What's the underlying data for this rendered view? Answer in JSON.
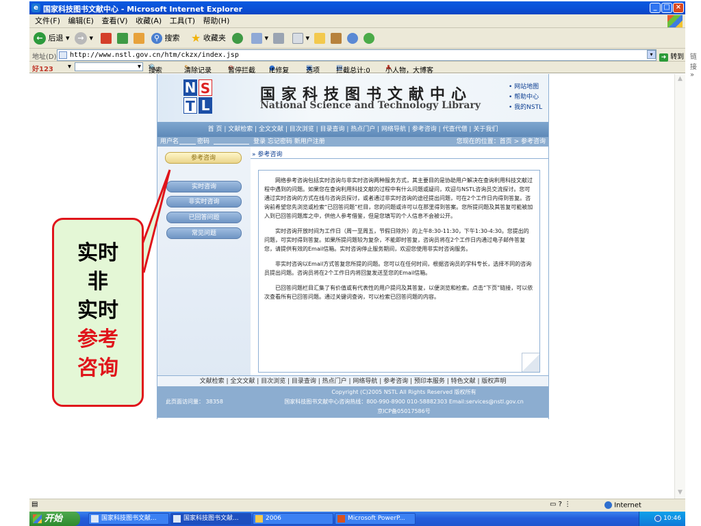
{
  "window": {
    "title": "国家科技图书文献中心 - Microsoft Internet Explorer"
  },
  "menu": [
    "文件(F)",
    "编辑(E)",
    "查看(V)",
    "收藏(A)",
    "工具(T)",
    "帮助(H)"
  ],
  "toolbar": {
    "back": "后退",
    "search": "搜索",
    "favorites": "收藏夹"
  },
  "address": {
    "label": "地址(D)",
    "url": "http://www.nstl.gov.cn/htm/ckzx/index.jsp",
    "go": "转到",
    "links": "链接"
  },
  "linksbar": {
    "brand": "好123",
    "search": "搜索",
    "clear": "清除记录",
    "block": "暂停拦截",
    "iefix": "IE修复",
    "options": "选项",
    "blocked": "拦截总计:0",
    "people": "小人物，大博客"
  },
  "site": {
    "logo_letters": [
      "N",
      "S",
      "T",
      "L"
    ],
    "title_cn": "国家科技图书文献中心",
    "title_en": "National Science and Technology Library",
    "toplinks": [
      "网站地图",
      "帮助中心",
      "我的NSTL"
    ],
    "nav": "首 页 | 文献检索 | 全文文献 | 目次浏览 | 目录查询 | 热点门户 | 网络导航 | 参考咨询 | 代查代借 | 关于我们",
    "login": {
      "user": "用户名",
      "password": "密码",
      "links": "登录 忘记密码 新用户注册",
      "location": "您现在的位置：首页 > 参考咨询"
    },
    "side_main": "参考咨询",
    "side_items": [
      "实时咨询",
      "非实时咨询",
      "已回答问题",
      "常见问题"
    ],
    "breadcrumb": "» 参考咨询",
    "paragraphs": [
      "网络参考咨询包括实时咨询与非实时咨询两种服务方式，其主要目的是协助用户解决在查询利用科技文献过程中遇到的问题。如果您在查询利用科技文献的过程中有什么问题或疑问，欢迎与NSTL咨询员交流探讨。您可通过实时咨询的方式在线与咨询员探讨，或者通过非实时咨询的途径提出问题，可在2个工作日内得到答复。咨询前希望您先浏览或检索“已回答问题”栏目，您的问题或许可以在那里得到答案。您所提问题及其答复可能被加入到已回答问题库之中，供他人参考借鉴，但是您填写的个人信息不会被公开。",
      "实时咨询开放时间为工作日（周一至周五，节假日除外）的上午8:30-11:30，下午1:30-4:30。您提出的问题，可实时得到答复。如果所提问题较为复杂，不能即时答复，咨询员将在2个工作日内通过电子邮件答复您，请提供有效的Email信箱。实时咨询停止服务期间，欢迎您使用非实时咨询服务。",
      "非实时咨询以Email方式答复您所提的问题。您可以在任何时间，根据咨询员的学科专长，选择不同的咨询员提出问题。咨询员将在2个工作日内将回复发送至您的Email信箱。",
      "已回答问题栏目汇集了有价值或有代表性的用户提问及其答复，以便浏览和检索。点击“下页”链接，可以依次查看所有已回答问题。通过关键词查询，可以检索已回答问题的内容。"
    ],
    "footnav": "文献检索 | 全文文献 | 目次浏览 | 目录查询 | 热点门户 | 网络导航 | 参考咨询 | 预印本服务 | 特色文献 | 版权声明",
    "visits": "此页面访问量：  38358",
    "copyright": [
      "Copyright (C)2005 NSTL All Rights Reserved 版权所有",
      "国家科技图书文献中心咨询热线：800-990-8900 010-58882303 Email:services@nstl.gov.cn",
      "京ICP备05017586号"
    ]
  },
  "callout": {
    "line1": "实时",
    "line2": "非",
    "line3": "实时",
    "line4": "参考",
    "line5": "咨询"
  },
  "status": {
    "zone": "Internet"
  },
  "taskbar": {
    "start": "开始",
    "tasks": [
      "国家科技图书文献...",
      "国家科技图书文献...",
      "2006",
      "Microsoft PowerP..."
    ],
    "time": "10:46"
  },
  "colors": {
    "accent_red": "#e0141b",
    "callout_bg": "#e4f7d6",
    "nav_blue": "#6f95c4"
  }
}
